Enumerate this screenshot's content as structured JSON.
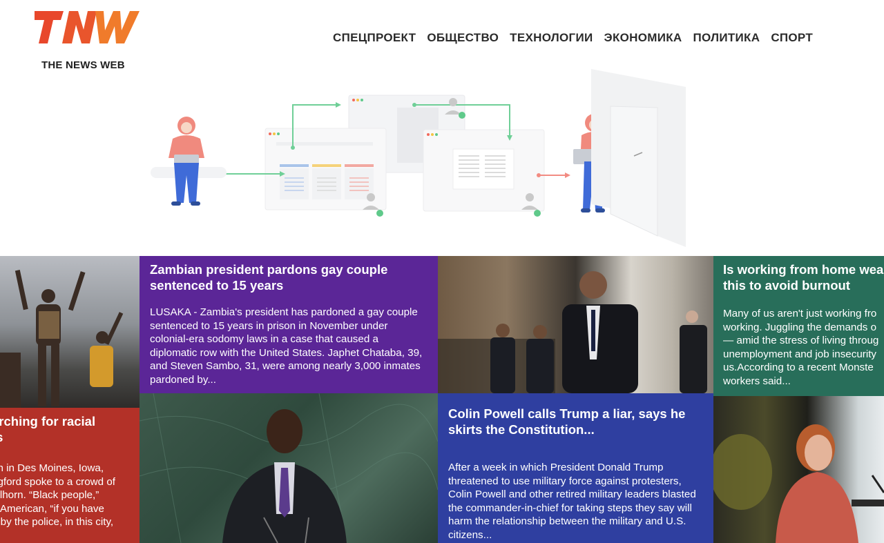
{
  "brand": {
    "logo_text": "TNW",
    "tagline": "THE NEWS WEB",
    "colors": {
      "logo_primary": "#e8472b",
      "logo_secondary": "#f07b2b"
    }
  },
  "nav": {
    "items": [
      {
        "label": "СПЕЦПРОЕКТ"
      },
      {
        "label": "ОБЩЕСТВО"
      },
      {
        "label": "ТЕХНОЛОГИИ"
      },
      {
        "label": "ЭКОНОМИКА"
      },
      {
        "label": "ПОЛИТИКА"
      },
      {
        "label": "СПОРТ"
      }
    ]
  },
  "articles": {
    "racial": {
      "title_line1": "arching for racial",
      "title_line2": "ts",
      "excerpt_lines": [
        "on in Des Moines, Iowa,",
        "ngford spoke to a crowd of",
        "ullhorn. “Black people,”",
        "n American, “if you have",
        "d by the police, in this city,"
      ],
      "color": "#b33128"
    },
    "zambia": {
      "title": "Zambian president pardons gay couple sentenced to 15 years",
      "excerpt": "LUSAKA - Zambia's president has pardoned a gay couple sentenced to 15 years in prison in November under colonial-era sodomy laws in a case that caused a diplomatic row with the United States. Japhet Chataba, 39, and Steven Sambo, 31, were among nearly 3,000 inmates pardoned by...",
      "color": "#5b2697"
    },
    "powell": {
      "title": "Colin Powell calls Trump a liar, says he skirts the Constitution...",
      "excerpt": "After a week in which President Donald Trump threatened to use military force against protesters, Colin Powell and other retired military leaders blasted the commander-in-chief for taking steps they say will harm the relationship between the military and U.S. citizens...",
      "color": "#2f3fa0"
    },
    "burnout": {
      "title_line1": "Is working from home wear",
      "title_line2": "this to avoid burnout",
      "excerpt_lines": [
        "Many of us aren't just working fro",
        "working. Juggling the demands o",
        "— amid the stress of living throug",
        "unemployment and job insecurity",
        "us.According to a recent Monste",
        "workers said..."
      ],
      "color": "#286e5a"
    }
  }
}
